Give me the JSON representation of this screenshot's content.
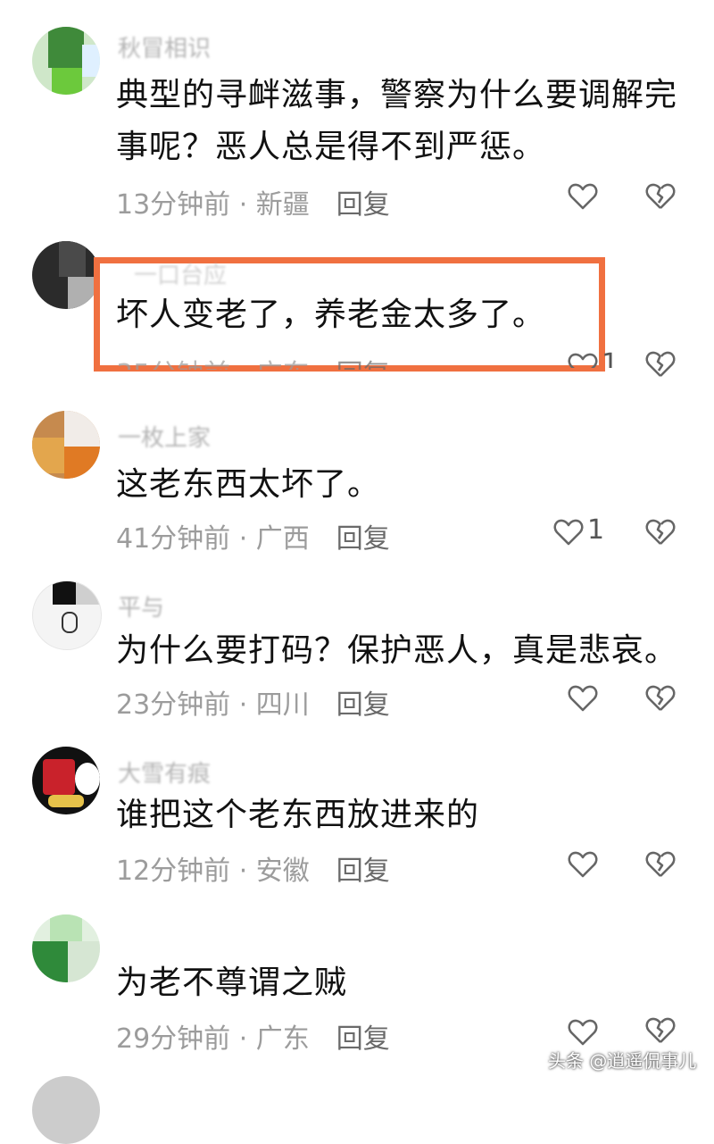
{
  "comments": [
    {
      "username": "秋冒相识",
      "text": "典型的寻衅滋事，警察为什么要调解完事呢？恶人总是得不到严惩。",
      "time": "13分钟前",
      "location": "新疆",
      "reply_label": "回复",
      "likes": ""
    },
    {
      "username": "一口台应",
      "text": "坏人变老了，养老金太多了。",
      "time": "35分钟前",
      "location": "广东",
      "reply_label": "回复",
      "likes": "1"
    },
    {
      "username": "一枚上家",
      "text": "这老东西太坏了。",
      "time": "41分钟前",
      "location": "广西",
      "reply_label": "回复",
      "likes": "1"
    },
    {
      "username": "平与",
      "text": "为什么要打码？保护恶人，真是悲哀。",
      "time": "23分钟前",
      "location": "四川",
      "reply_label": "回复",
      "likes": ""
    },
    {
      "username": "大雪有痕",
      "text": "谁把这个老东西放进来的",
      "time": "12分钟前",
      "location": "安徽",
      "reply_label": "回复",
      "likes": ""
    },
    {
      "username": "",
      "text": "为老不尊谓之贼",
      "time": "29分钟前",
      "location": "广东",
      "reply_label": "回复",
      "likes": ""
    }
  ],
  "separator": " · ",
  "watermark": "头条 @逍遥侃事儿",
  "colors": {
    "highlight_border": "#f07040",
    "meta_text": "#9c9c9c",
    "icon_stroke": "#666666"
  }
}
